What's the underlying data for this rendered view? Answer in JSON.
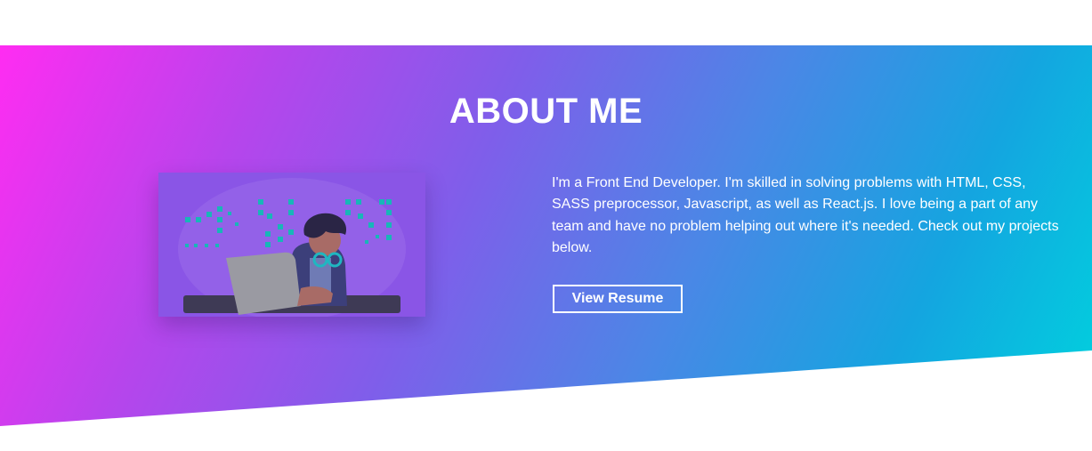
{
  "about": {
    "title": "ABOUT ME",
    "bio": "I'm a Front End Developer. I'm skilled in solving problems with HTML, CSS, SASS preprocessor, Javascript, as well as React.js. I love being a part of any team and have no problem helping out where it's needed. Check out my projects below.",
    "resume_button": "View Resume"
  },
  "colors": {
    "gradient_start": "#ff2cf2",
    "gradient_mid": "#7f5eea",
    "gradient_end": "#00d2de",
    "text": "#ffffff"
  },
  "illustration": {
    "description_icon": "developer-at-laptop-illustration"
  }
}
